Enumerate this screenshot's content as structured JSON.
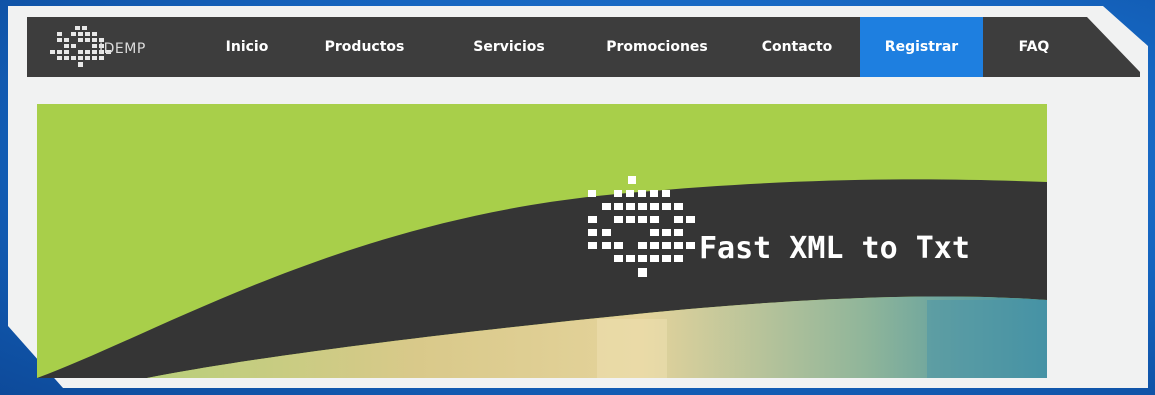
{
  "brand": {
    "logo_text": "IDEMP"
  },
  "nav": {
    "items": [
      {
        "label": "Inicio"
      },
      {
        "label": "Productos"
      },
      {
        "label": "Servicios"
      },
      {
        "label": "Promociones"
      },
      {
        "label": "Contacto"
      },
      {
        "label": "Registrar",
        "active": true
      },
      {
        "label": "FAQ"
      }
    ]
  },
  "hero": {
    "title": "Fast XML to Txt"
  },
  "colors": {
    "page_background": "#1565c0",
    "navbar": "#3d3d3d",
    "nav_active": "#1e7fe0",
    "hero_green": "#a8cf4a",
    "hero_dark_band": "#353535"
  }
}
